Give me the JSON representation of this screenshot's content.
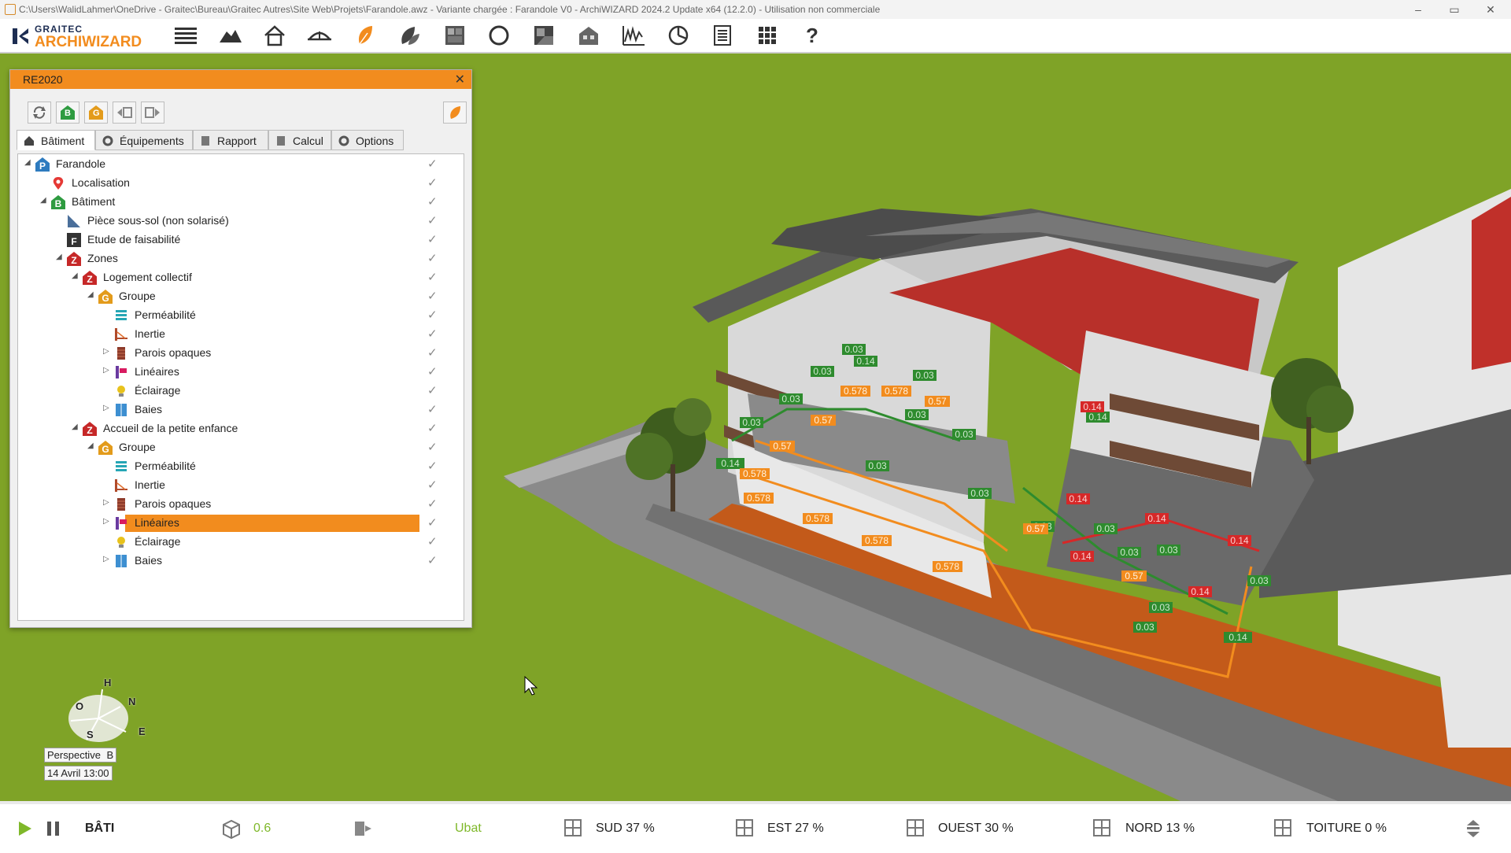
{
  "titlebar": {
    "title": "C:\\Users\\WalidLahmer\\OneDrive - Graitec\\Bureau\\Graitec Autres\\Site Web\\Projets\\Farandole.awz - Variante chargée : Farandole V0  -  ArchiWIZARD 2024.2 Update x64 (12.2.0) - Utilisation non commerciale",
    "minimize": "–",
    "maximize": "▭",
    "close": "✕"
  },
  "logo": {
    "brand": "GRAITEC",
    "product": "ARCHIWIZARD"
  },
  "toolbar": {
    "icons": [
      "menu-icon",
      "terrain-icon",
      "house-icon",
      "sun-path-icon",
      "leaf-icon",
      "leaves-icon",
      "window-icon",
      "circle-icon",
      "panel-icon",
      "building-icon",
      "chart-icon",
      "pie-chart-icon",
      "report-icon",
      "grid-icon",
      "help-icon"
    ],
    "help_label": "?"
  },
  "panel": {
    "title": "RE2020",
    "close": "✕",
    "tool_labels": [
      "B",
      "G"
    ],
    "tabs": [
      {
        "label": "Bâtiment",
        "active": true
      },
      {
        "label": "Équipements",
        "active": false
      },
      {
        "label": "Rapport",
        "active": false
      },
      {
        "label": "Calcul",
        "active": false
      },
      {
        "label": "Options",
        "active": false
      }
    ],
    "tree": [
      {
        "label": "Farandole",
        "indent": 0,
        "expander": "◢",
        "icon": "P",
        "color": "#2e7bbf"
      },
      {
        "label": "Localisation",
        "indent": 1,
        "expander": "",
        "icon": "pin",
        "color": "#e53935"
      },
      {
        "label": "Bâtiment",
        "indent": 1,
        "expander": "◢",
        "icon": "B",
        "color": "#2e9b40"
      },
      {
        "label": "Pièce sous-sol (non solarisé)",
        "indent": 2,
        "expander": "",
        "icon": "room",
        "color": "#4a6f9a"
      },
      {
        "label": "Etude de faisabilité",
        "indent": 2,
        "expander": "",
        "icon": "F",
        "color": "#333333"
      },
      {
        "label": "Zones",
        "indent": 2,
        "expander": "◢",
        "icon": "Z",
        "color": "#c62828"
      },
      {
        "label": "Logement collectif",
        "indent": 3,
        "expander": "◢",
        "icon": "Z",
        "color": "#c62828"
      },
      {
        "label": "Groupe",
        "indent": 4,
        "expander": "◢",
        "icon": "G",
        "color": "#e39b1b"
      },
      {
        "label": "Perméabilité",
        "indent": 5,
        "expander": "",
        "icon": "perm",
        "color": "#26a6b5"
      },
      {
        "label": "Inertie",
        "indent": 5,
        "expander": "",
        "icon": "inertie",
        "color": "#b04a2a"
      },
      {
        "label": "Parois opaques",
        "indent": 5,
        "expander": "▷",
        "icon": "wall",
        "color": "#8d3a2a"
      },
      {
        "label": "Linéaires",
        "indent": 5,
        "expander": "▷",
        "icon": "lin",
        "color": "#d81b60"
      },
      {
        "label": "Éclairage",
        "indent": 5,
        "expander": "",
        "icon": "bulb",
        "color": "#e8c21c"
      },
      {
        "label": "Baies",
        "indent": 5,
        "expander": "▷",
        "icon": "baie",
        "color": "#3d8fd1"
      },
      {
        "label": "Accueil de la petite enfance",
        "indent": 3,
        "expander": "◢",
        "icon": "Z",
        "color": "#c62828"
      },
      {
        "label": "Groupe",
        "indent": 4,
        "expander": "◢",
        "icon": "G",
        "color": "#e39b1b"
      },
      {
        "label": "Perméabilité",
        "indent": 5,
        "expander": "",
        "icon": "perm",
        "color": "#26a6b5"
      },
      {
        "label": "Inertie",
        "indent": 5,
        "expander": "",
        "icon": "inertie",
        "color": "#b04a2a"
      },
      {
        "label": "Parois opaques",
        "indent": 5,
        "expander": "▷",
        "icon": "wall",
        "color": "#8d3a2a"
      },
      {
        "label": "Linéaires",
        "indent": 5,
        "expander": "▷",
        "icon": "lin",
        "color": "#d81b60",
        "selected": true
      },
      {
        "label": "Éclairage",
        "indent": 5,
        "expander": "",
        "icon": "bulb",
        "color": "#e8c21c"
      },
      {
        "label": "Baies",
        "indent": 5,
        "expander": "▷",
        "icon": "baie",
        "color": "#3d8fd1"
      }
    ],
    "check_mark": "✓"
  },
  "scene": {
    "labels_green": [
      "0.03",
      "0.14",
      "0.03",
      "0.03",
      "0.03",
      "0.03",
      "0.03",
      "0.03",
      "0.14",
      "0.03",
      "0.03",
      "0.14",
      "0.03",
      "0.03",
      "0.03",
      "0.03",
      "0.03",
      "0.03",
      "0.14",
      "0.03"
    ],
    "labels_orange": [
      "0.578",
      "0.578",
      "0.57",
      "0.578",
      "0.57",
      "0.57",
      "0.578",
      "0.578",
      "0.578",
      "0.57",
      "0.578",
      "0.57"
    ],
    "labels_red": [
      "0.14",
      "0.14",
      "0.14",
      "0.14",
      "0.14",
      "0.14"
    ]
  },
  "compass": {
    "h": "H",
    "n": "N",
    "o": "O",
    "e": "E",
    "s": "S"
  },
  "camera": {
    "view": "Perspective",
    "view_badge": "B",
    "date": "14 Avril 13:00"
  },
  "statusbar": {
    "mode": "BÂTI",
    "value": "0.6",
    "ubat": "Ubat",
    "orientations": [
      {
        "label": "SUD 37 %"
      },
      {
        "label": "EST  27 %"
      },
      {
        "label": "OUEST  30 %"
      },
      {
        "label": "NORD 13 %"
      },
      {
        "label": "TOITURE  0 %"
      }
    ]
  }
}
